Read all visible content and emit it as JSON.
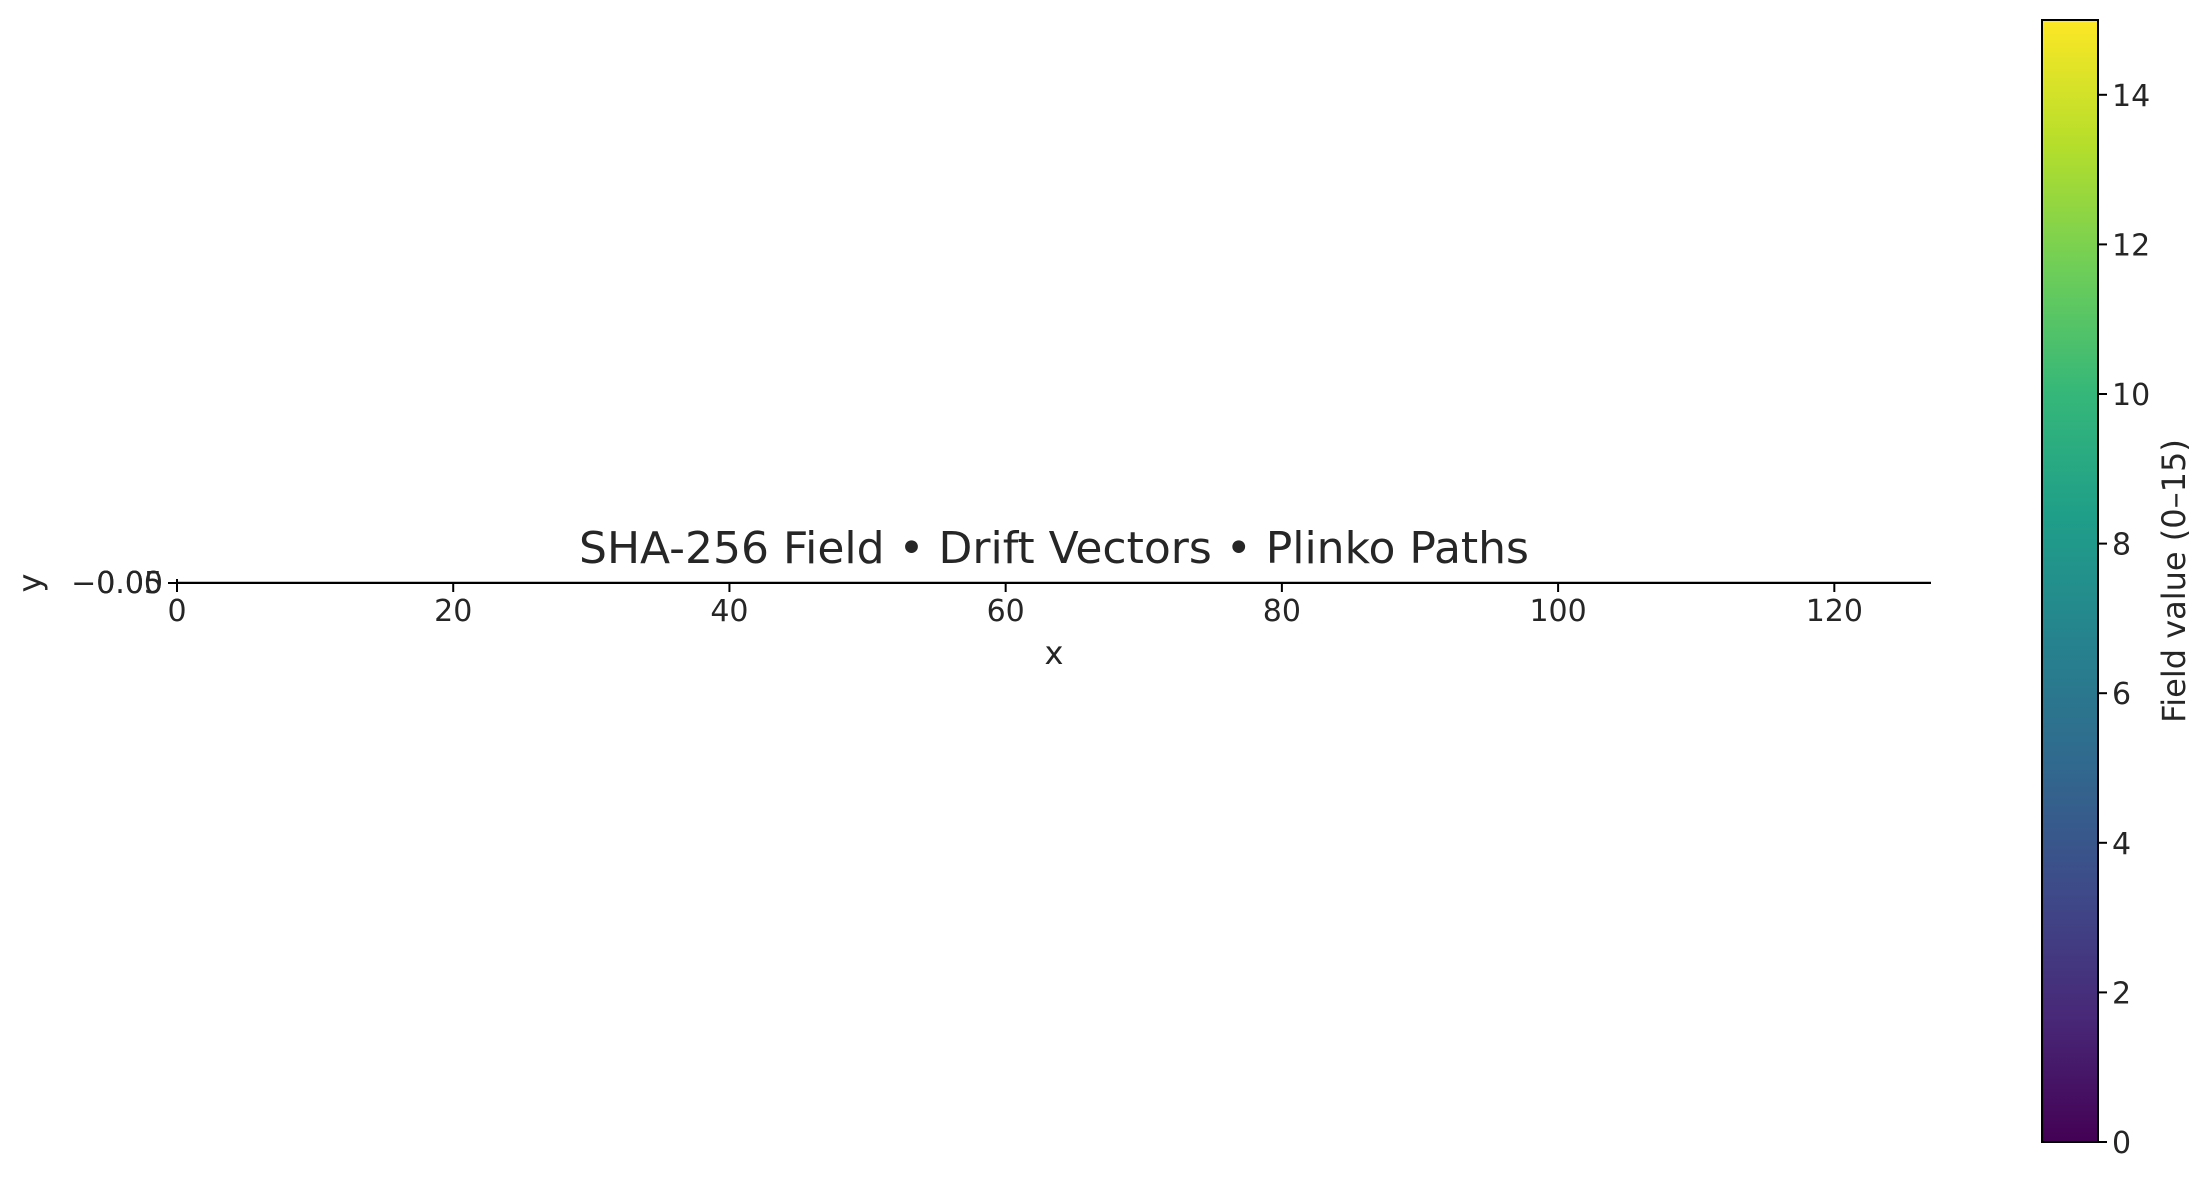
{
  "chart_data": {
    "type": "heatmap",
    "title": "SHA-256 Field • Drift Vectors • Plinko Paths",
    "xlabel": "x",
    "ylabel": "y",
    "xlim": [
      0,
      127
    ],
    "ylim": [
      -0.05,
      0.05
    ],
    "x_ticks": [
      0,
      20,
      40,
      60,
      80,
      100,
      120
    ],
    "x_tick_labels": [
      "0",
      "20",
      "40",
      "60",
      "80",
      "100",
      "120"
    ],
    "y_ticks": [
      -0.05,
      -0.05
    ],
    "y_tick_labels": [
      "−0.05",
      "0.00"
    ],
    "grid": false,
    "colorbar": {
      "label": "Field value (0–15)",
      "colormap": "viridis",
      "range": [
        0,
        15
      ],
      "ticks": [
        0,
        2,
        4,
        6,
        8,
        10,
        12,
        14
      ],
      "tick_labels": [
        "0",
        "2",
        "4",
        "6",
        "8",
        "10",
        "12",
        "14"
      ]
    },
    "colors": {
      "text": "#262626",
      "axis": "#000000",
      "viridis_stops": [
        "#440154",
        "#482878",
        "#3e4a89",
        "#31688e",
        "#26828e",
        "#1f9e89",
        "#35b779",
        "#6ece58",
        "#b5de2b",
        "#fde725"
      ]
    }
  }
}
